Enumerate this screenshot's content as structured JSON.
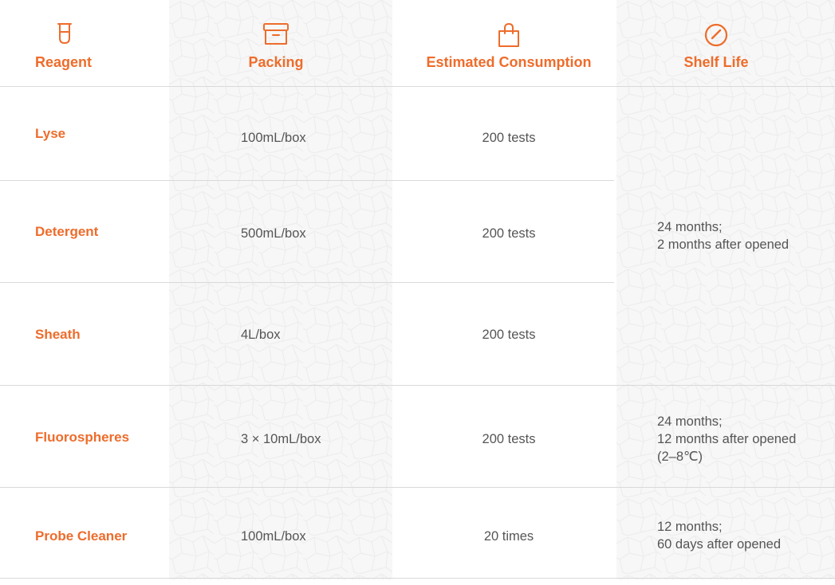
{
  "header": {
    "reagent": "Reagent",
    "packing": "Packing",
    "consumption": "Estimated Consumption",
    "shelf_life": "Shelf Life"
  },
  "icons": {
    "reagent": "beaker-icon",
    "packing": "box-icon",
    "consumption": "shopping-bag-icon",
    "shelf_life": "gauge-icon"
  },
  "rows": [
    {
      "reagent": "Lyse",
      "packing": "100mL/box",
      "consumption": "200 tests"
    },
    {
      "reagent": "Detergent",
      "packing": "500mL/box",
      "consumption": "200 tests"
    },
    {
      "reagent": "Sheath",
      "packing": "4L/box",
      "consumption": "200 tests"
    },
    {
      "reagent": "Fluorospheres",
      "packing": "3 × 10mL/box",
      "consumption": "200 tests"
    },
    {
      "reagent": "Probe Cleaner",
      "packing": "100mL/box",
      "consumption": "20 times"
    }
  ],
  "shelf_life": [
    {
      "lines": [
        "24 months;",
        "2 months after opened"
      ]
    },
    {
      "lines": [
        "24 months;",
        "12 months after opened",
        "(2–8℃)"
      ]
    },
    {
      "lines": [
        "12 months;",
        "60 days after opened"
      ]
    }
  ],
  "colors": {
    "accent": "#ee6c2b",
    "text": "#555555",
    "divider": "#d9d9d9",
    "band": "#f7f7f7"
  }
}
